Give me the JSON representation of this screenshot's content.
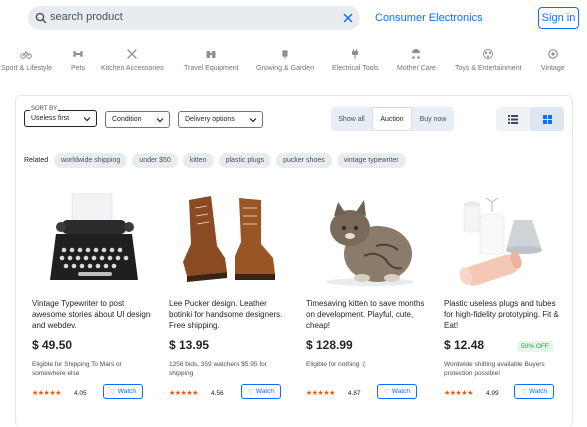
{
  "search": {
    "value": "search product"
  },
  "header": {
    "category_link": "Consumer Electronics",
    "signin_label": "Sign in"
  },
  "categories": [
    {
      "label": "Sport & Lifestyle",
      "icon": "bicycle-icon"
    },
    {
      "label": "Pets",
      "icon": "bone-icon"
    },
    {
      "label": "Kitchen Accessories",
      "icon": "utensils-icon"
    },
    {
      "label": "Travel Equipment",
      "icon": "binoculars-icon"
    },
    {
      "label": "Growing & Garden",
      "icon": "wheat-icon"
    },
    {
      "label": "Electrical Tools",
      "icon": "plug-icon"
    },
    {
      "label": "Mother Care",
      "icon": "stroller-icon"
    },
    {
      "label": "Toys & Entertainment",
      "icon": "toy-icon"
    },
    {
      "label": "Vintage",
      "icon": "gem-icon"
    }
  ],
  "filters": {
    "sort_label": "SORT BY",
    "sort_value": "Useless first",
    "condition": "Condition",
    "delivery": "Delivery options"
  },
  "listing_type": {
    "options": [
      "Show all",
      "Auction",
      "Buy now"
    ],
    "active": "Auction"
  },
  "view_toggle": {
    "list_icon": "list-icon",
    "grid_icon": "grid-icon",
    "active": "grid"
  },
  "related": {
    "label": "Related",
    "chips": [
      "worldwide shipping",
      "under $50",
      "kitten",
      "plastic plugs",
      "pucker shoes",
      "vintage typewriter"
    ]
  },
  "products": [
    {
      "title": "Vintage Typewriter to post awesome stories about UI design and webdev.",
      "price": "$ 49.50",
      "note": "Eligible for Shipping To Mars or somewhere else",
      "stars": "★★★★★",
      "rating": "4.05",
      "watch_label": "Watch",
      "image": "typewriter"
    },
    {
      "title": "Lee Pucker design. Leather botinki for handsome designers. Free shipping.",
      "price": "$ 13.95",
      "note": "1258 bids, 359 watchers $5.95 for shipping",
      "stars": "★★★★★",
      "rating": "4.56",
      "watch_label": "Watch",
      "image": "boots"
    },
    {
      "title": "Timesaving kitten to save months on development. Playful, cute, cheap!",
      "price": "$ 128.99",
      "note": "Eligible for nothing :(",
      "stars": "★★★★★",
      "rating": "4.87",
      "watch_label": "Watch",
      "image": "kitten"
    },
    {
      "title": "Plastic useless plugs and tubes for high-fidelity prototyping. Fit & Eat!",
      "price": "$ 12.48",
      "badge": "50% OFF",
      "note": "Wordwide shitting available Buyers protection possible!",
      "stars": "★★★★★",
      "rating": "4.99",
      "watch_label": "Watch",
      "image": "plugs"
    }
  ],
  "colors": {
    "accent": "#0d6efd",
    "star": "#e8590c",
    "badge_text": "#2f9e44",
    "chip_bg": "#e9ecef"
  }
}
